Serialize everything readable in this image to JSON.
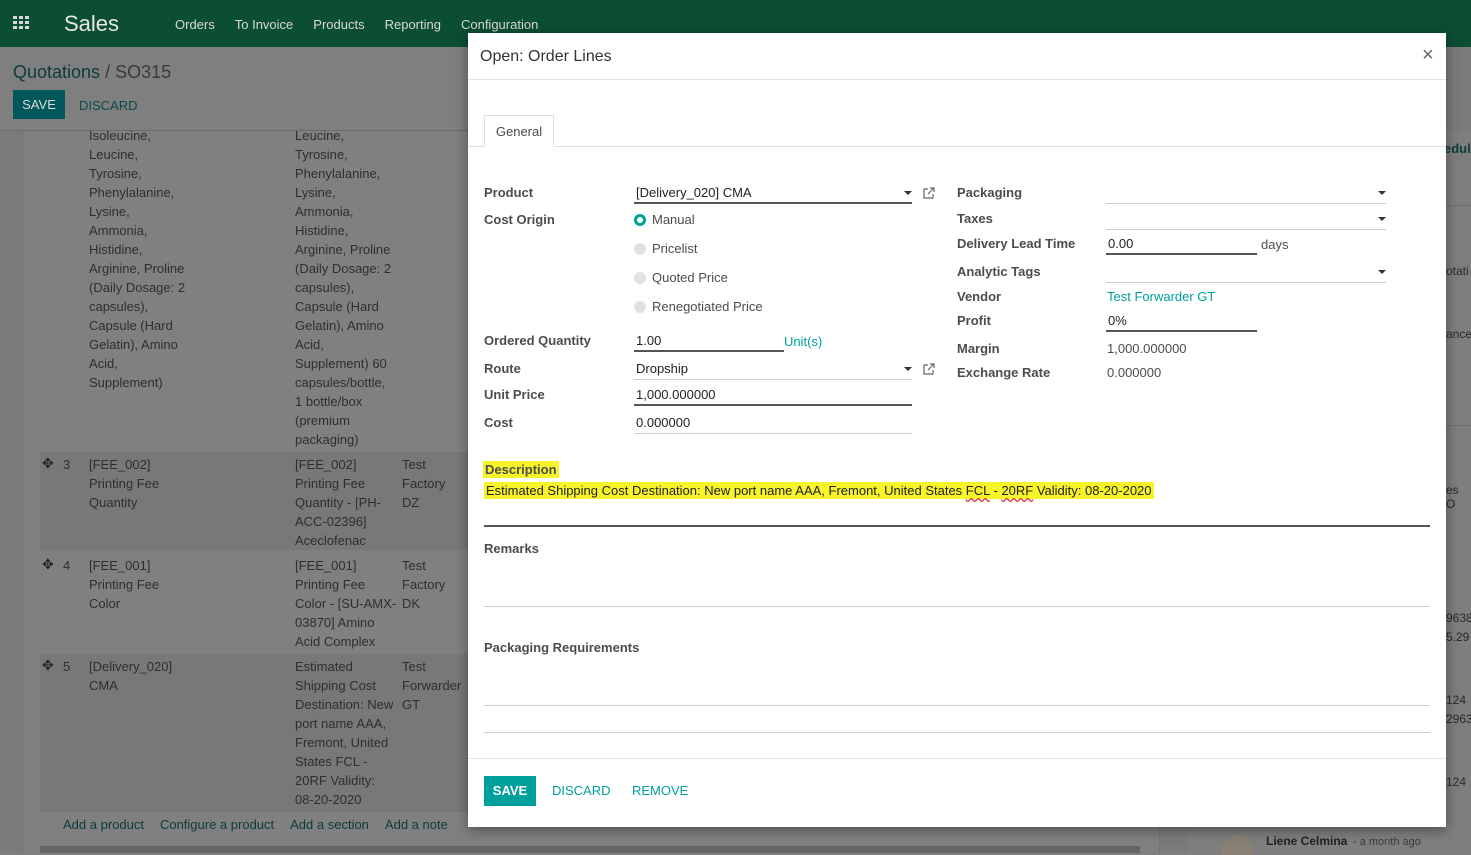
{
  "topbar": {
    "app_name": "Sales",
    "menu": [
      "Orders",
      "To Invoice",
      "Products",
      "Reporting",
      "Configuration"
    ]
  },
  "breadcrumb": {
    "parent": "Quotations",
    "separator": "/",
    "current": "SO315"
  },
  "control": {
    "save_label": "SAVE",
    "discard_label": "DISCARD"
  },
  "background_lines": {
    "first_row": {
      "col1": "Isoleucine,\nLeucine,\nTyrosine,\nPhenylalanine,\nLysine,\nAmmonia,\nHistidine,\nArginine, Proline\n(Daily Dosage: 2\ncapsules),\nCapsule (Hard\nGelatin), Amino\nAcid,\nSupplement)",
      "col2": "Leucine,\nTyrosine,\nPhenylalanine,\nLysine,\nAmmonia,\nHistidine,\nArginine, Proline\n(Daily Dosage: 2\ncapsules),\nCapsule (Hard\nGelatin), Amino\nAcid,\nSupplement) 60\ncapsules/bottle,\n1 bottle/box\n(premium\npackaging)"
    },
    "rows": [
      {
        "num": "3",
        "product": "[FEE_002]\nPrinting Fee\nQuantity",
        "desc": "[FEE_002]\nPrinting Fee\nQuantity - [PH-\nACC-02396]\nAceclofenac",
        "vendor": "Test\nFactory\nDZ"
      },
      {
        "num": "4",
        "product": "[FEE_001]\nPrinting Fee\nColor",
        "desc": "[FEE_001]\nPrinting Fee\nColor - [SU-AMX-\n03870] Amino\nAcid Complex",
        "vendor": "Test\nFactory\nDK"
      },
      {
        "num": "5",
        "product": "[Delivery_020]\nCMA",
        "desc": "Estimated\nShipping Cost\nDestination: New\nport name AAA,\nFremont, United\nStates FCL -\n20RF Validity:\n08-20-2020",
        "vendor": "Test\nForwarder\nGT"
      }
    ],
    "links": [
      "Add a product",
      "Configure a product",
      "Add a section",
      "Add a note"
    ]
  },
  "chatter_fragments": [
    "edule",
    "otati",
    "ance",
    "es O",
    "9638",
    "5.29",
    "124 -",
    "2963",
    "124"
  ],
  "chatter_author": {
    "name": "Liene Celmina",
    "time": "- a month ago"
  },
  "modal": {
    "title": "Open: Order Lines",
    "close": "×",
    "tab": "General",
    "left": {
      "product_label": "Product",
      "product_value": "[Delivery_020] CMA",
      "cost_origin_label": "Cost Origin",
      "cost_origin_options": [
        "Manual",
        "Pricelist",
        "Quoted Price",
        "Renegotiated Price"
      ],
      "cost_origin_selected": "Manual",
      "ordered_qty_label": "Ordered Quantity",
      "ordered_qty_value": "1.00",
      "uom": "Unit(s)",
      "route_label": "Route",
      "route_value": "Dropship",
      "unit_price_label": "Unit Price",
      "unit_price_value": "1,000.000000",
      "cost_label": "Cost",
      "cost_value": "0.000000"
    },
    "right": {
      "packaging_label": "Packaging",
      "packaging_value": "",
      "taxes_label": "Taxes",
      "taxes_value": "",
      "lead_time_label": "Delivery Lead Time",
      "lead_time_value": "0.00",
      "lead_time_unit": "days",
      "analytic_tags_label": "Analytic Tags",
      "analytic_tags_value": "",
      "vendor_label": "Vendor",
      "vendor_value": "Test Forwarder GT",
      "profit_label": "Profit",
      "profit_value": "0%",
      "margin_label": "Margin",
      "margin_value": "1,000.000000",
      "exchange_rate_label": "Exchange Rate",
      "exchange_rate_value": "0.000000"
    },
    "description_label": "Description",
    "description_parts": [
      "Estimated Shipping Cost Destination: New port name AAA, Fremont, United States ",
      "FCL",
      " - ",
      "20RF",
      " Validity: 08-20-2020"
    ],
    "remarks_label": "Remarks",
    "packaging_req_label": "Packaging Requirements",
    "footer": {
      "save": "SAVE",
      "discard": "DISCARD",
      "remove": "REMOVE"
    },
    "highlight_color": "#f7f42a",
    "accent_color": "#00a09d"
  }
}
